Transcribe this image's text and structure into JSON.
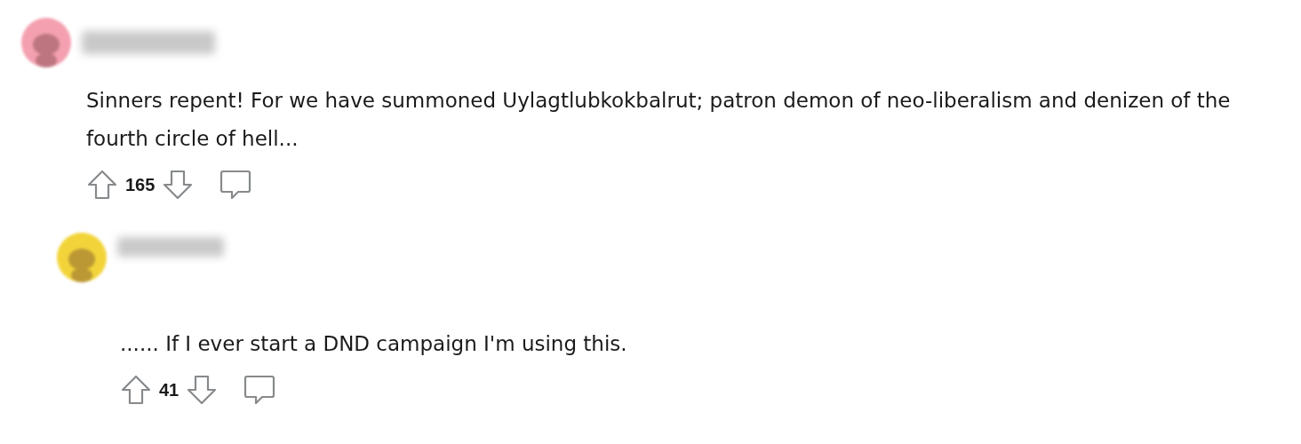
{
  "comments": [
    {
      "color": "#f4a0b0",
      "text": "Sinners repent! For we have summoned Uylagtlubkokbalrut; patron demon of neo-liberalism and denizen of the fourth circle of hell...",
      "score": "165",
      "children": [
        {
          "color": "#f2d43a",
          "text": "...... If I ever start a DND campaign I'm using this.",
          "score": "41"
        }
      ]
    }
  ]
}
